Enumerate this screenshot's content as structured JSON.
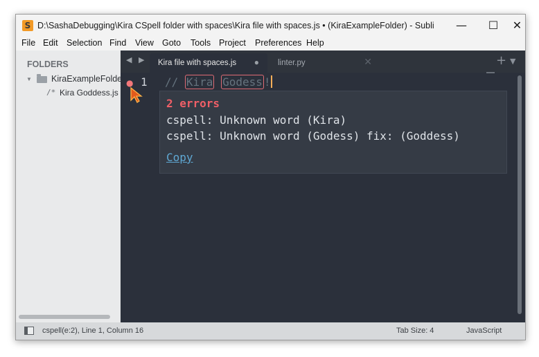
{
  "window": {
    "title": "D:\\SashaDebugging\\Kira CSpell folder with spaces\\Kira file with spaces.js • (KiraExampleFolder) - Sublime...",
    "controls": {
      "minimize": "—",
      "maximize": "☐",
      "close": "✕"
    }
  },
  "menu": [
    "File",
    "Edit",
    "Selection",
    "Find",
    "View",
    "Goto",
    "Tools",
    "Project",
    "Preferences",
    "Help"
  ],
  "sidebar": {
    "header": "FOLDERS",
    "folder": "KiraExampleFolder",
    "file_prefix": "/*",
    "file": "Kira Goddess.js"
  },
  "tabs": {
    "nav": "◀ ▶",
    "active": {
      "label": "Kira file with spaces.js",
      "modified_marker": "●"
    },
    "inactive": {
      "label": "linter.py",
      "close": "✕"
    },
    "new_tab": "+",
    "tab_list": "▼"
  },
  "editor": {
    "gutter_marker": "●",
    "line_number": "1",
    "code_prefix": "// ",
    "word1": "Kira",
    "word2": "Godess",
    "code_suffix": "!"
  },
  "popup": {
    "title": "2 errors",
    "line1": "cspell: Unknown word (Kira)",
    "line2": "cspell: Unknown word (Godess) fix: (Goddess)",
    "copy": "Copy"
  },
  "status": {
    "position": "cspell(e:2), Line 1, Column 16",
    "tab_size": "Tab Size: 4",
    "syntax": "JavaScript"
  },
  "colors": {
    "editor_bg": "#2b303b",
    "error": "#ef5f67",
    "link": "#5fa8d3",
    "accent": "#f29a27"
  }
}
